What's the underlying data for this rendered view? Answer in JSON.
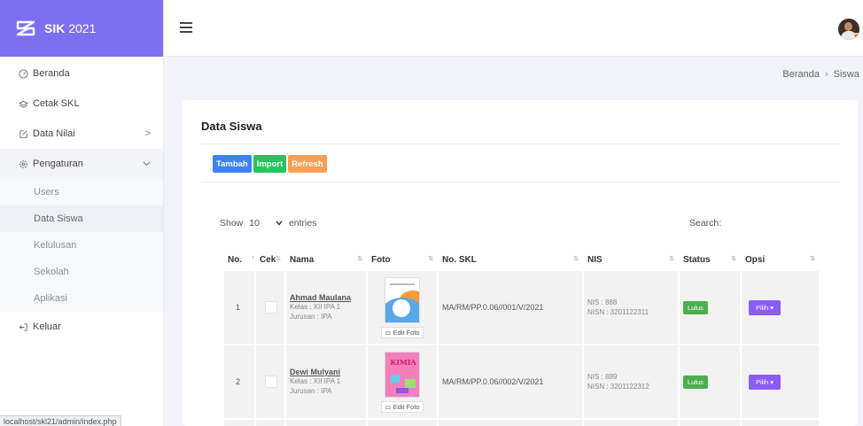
{
  "app": {
    "brand": "SIK",
    "year": "2021"
  },
  "sidebar": {
    "items": [
      {
        "label": "Beranda",
        "icon": "speedometer-icon"
      },
      {
        "label": "Cetak SKL",
        "icon": "layers-icon"
      },
      {
        "label": "Data Nilai",
        "icon": "edit-icon"
      },
      {
        "label": "Pengaturan",
        "icon": "gear-icon"
      },
      {
        "label": "Keluar",
        "icon": "logout-icon"
      }
    ],
    "submenu": [
      "Users",
      "Data Siswa",
      "Kelulusan",
      "Sekolah",
      "Aplikasi"
    ]
  },
  "statusbar": "localhost/skl21/admin/index.php",
  "breadcrumb": {
    "home": "Beranda",
    "sep": "›",
    "current": "Siswa"
  },
  "card": {
    "title": "Data Siswa",
    "buttons": {
      "add": "Tambah",
      "import": "Import",
      "refresh": "Refresh"
    },
    "length": {
      "show": "Show",
      "value": "10",
      "entries": "entries"
    },
    "search": "Search:"
  },
  "table": {
    "headers": [
      "No.",
      "Cek",
      "Nama",
      "Foto",
      "No. SKL",
      "NIS",
      "Status",
      "Opsi"
    ],
    "edit_label": "Edit Foto",
    "option_label": "Pilih ▾",
    "rows": [
      {
        "no": "1",
        "nama": "Ahmad Maulana",
        "kelas": "Kelas : XII IPA 1",
        "jurusan": "Jurusan : IPA",
        "skl": "MA/RM/PP.0.06//001/V/2021",
        "nis": "NIS : 888",
        "nisn": "NISN : 3201122311",
        "status": "Lulus"
      },
      {
        "no": "2",
        "nama": "Dewi Mulyani",
        "kelas": "Kelas : XII IPA 1",
        "jurusan": "Jurusan : IPA",
        "skl": "MA/RM/PP.0.06//002/V/2021",
        "nis": "NIS : 889",
        "nisn": "NISN : 3201122312",
        "status": "Lulus"
      }
    ],
    "thumb_b_title": "KIMIA"
  },
  "colors": {
    "brand": "#7d6ff0",
    "tambah": "#3b82f6",
    "import": "#22c55e",
    "refresh": "#f59f57",
    "lulus": "#4caf50",
    "pilih": "#8b5cf6"
  }
}
